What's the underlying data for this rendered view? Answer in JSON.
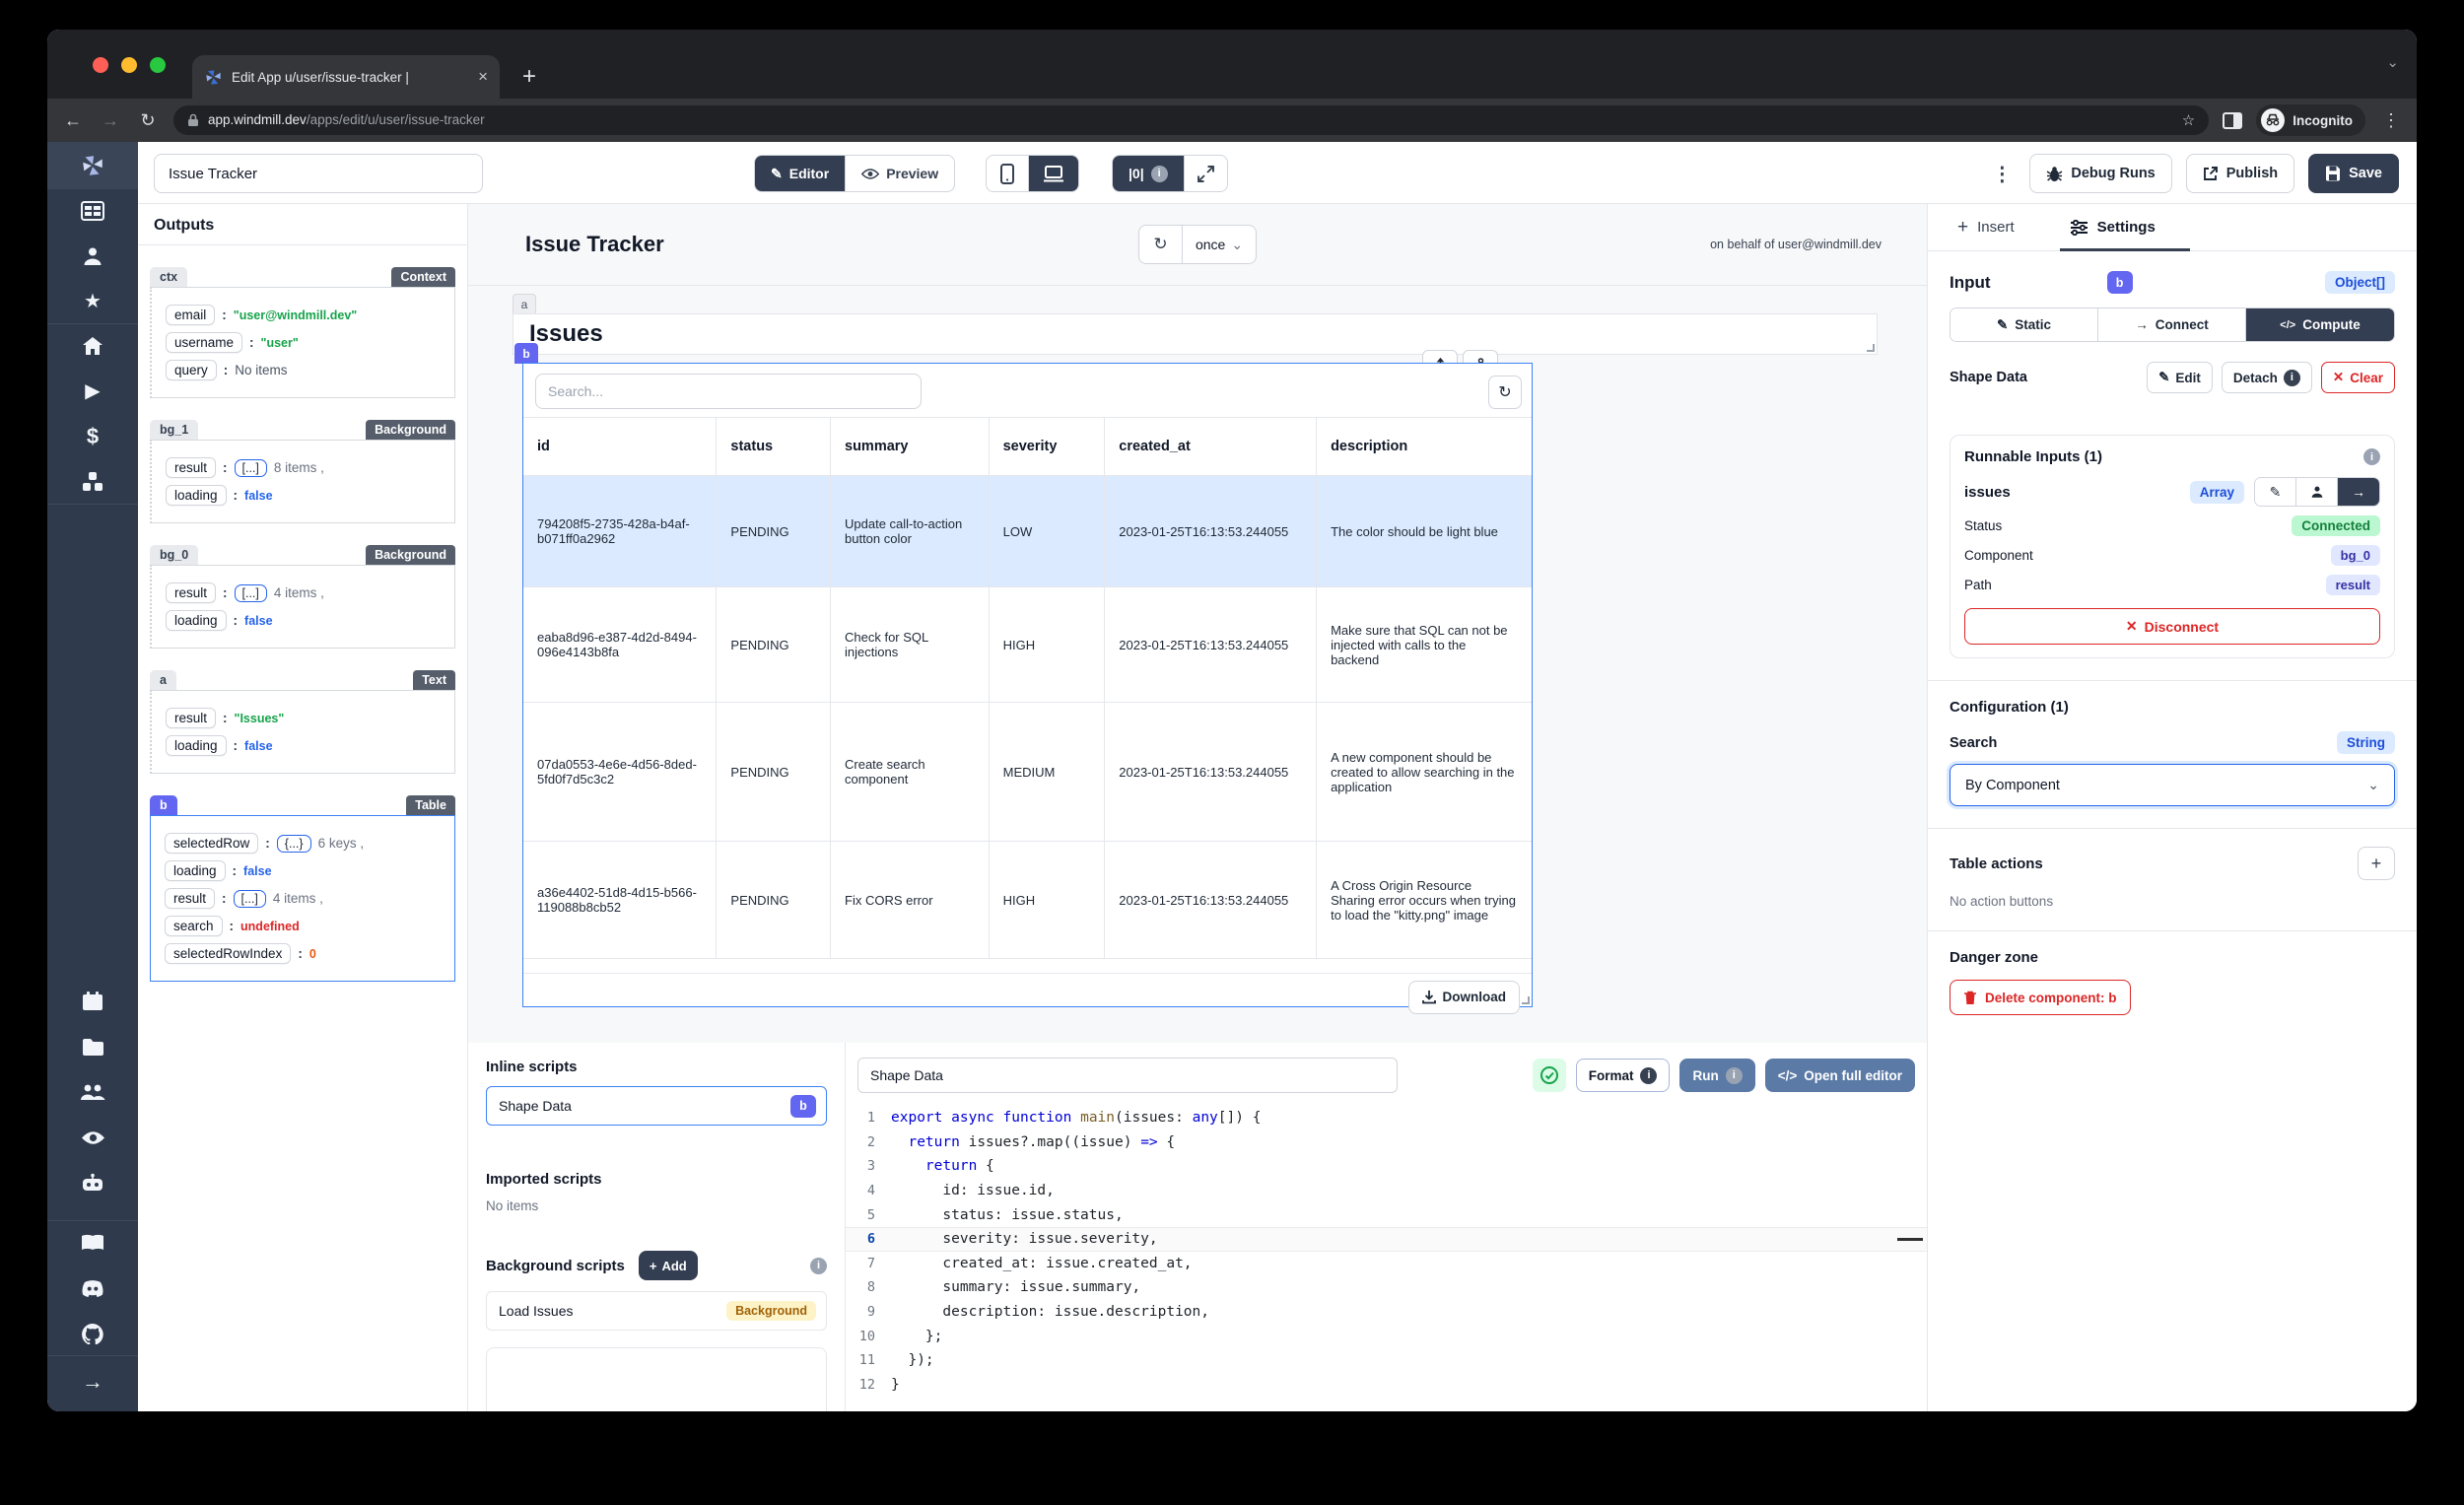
{
  "punct": {
    "colon": ":"
  },
  "icons": {
    "back": "←",
    "forward": "→",
    "reload": "↻",
    "more": "⋮",
    "plus": "+",
    "close": "×",
    "chevron_down": "⌄",
    "star": "☆",
    "pencil": "✎",
    "refresh": "↻",
    "code": "</>",
    "zero": "|0|",
    "arrow_right": "→",
    "times": "✕",
    "info": "i",
    "dollar": "$",
    "play": "▶",
    "home": "⌂",
    "star_filled": "★",
    "check": "✓"
  },
  "browser": {
    "tab_title": "Edit App u/user/issue-tracker |",
    "url_host": "app.windmill.dev",
    "url_path": "/apps/edit/u/user/issue-tracker",
    "incognito_label": "Incognito"
  },
  "toolbar": {
    "app_name_value": "Issue Tracker",
    "editor_label": "Editor",
    "preview_label": "Preview",
    "debug_runs_label": "Debug Runs",
    "publish_label": "Publish",
    "save_label": "Save"
  },
  "outputs": {
    "title": "Outputs",
    "sections": [
      {
        "id": "ctx",
        "badge": "Context",
        "rows": [
          {
            "key": "email",
            "value": "\"user@windmill.dev\""
          },
          {
            "key": "username",
            "value": "\"user\""
          },
          {
            "key": "query",
            "value": "No items"
          }
        ]
      },
      {
        "id": "bg_1",
        "badge": "Background",
        "rows": [
          {
            "key": "result",
            "chip": "[...]",
            "meta": "8 items ,"
          },
          {
            "key": "loading",
            "value": "false"
          }
        ]
      },
      {
        "id": "bg_0",
        "badge": "Background",
        "rows": [
          {
            "key": "result",
            "chip": "[...]",
            "meta": "4 items ,"
          },
          {
            "key": "loading",
            "value": "false"
          }
        ]
      },
      {
        "id": "a",
        "badge": "Text",
        "rows": [
          {
            "key": "result",
            "value": "\"Issues\""
          },
          {
            "key": "loading",
            "value": "false"
          }
        ]
      },
      {
        "id": "b",
        "badge": "Table",
        "rows": [
          {
            "key": "selectedRow",
            "chip": "{...}",
            "meta": "6 keys ,"
          },
          {
            "key": "loading",
            "value": "false"
          },
          {
            "key": "result",
            "chip": "[...]",
            "meta": "4 items ,"
          },
          {
            "key": "search",
            "value": "undefined"
          },
          {
            "key": "selectedRowIndex",
            "value": "0"
          }
        ]
      }
    ]
  },
  "canvas": {
    "app_title": "Issue Tracker",
    "refresh_mode": "once",
    "on_behalf": "on behalf of user@windmill.dev",
    "text_component": {
      "tag": "a",
      "text": "Issues"
    },
    "table": {
      "tag": "b",
      "search_placeholder": "Search...",
      "download_label": "Download",
      "columns": [
        "id",
        "status",
        "summary",
        "severity",
        "created_at",
        "description"
      ],
      "rows": [
        [
          "794208f5-2735-428a-b4af-b071ff0a2962",
          "PENDING",
          "Update call-to-action button color",
          "LOW",
          "2023-01-25T16:13:53.244055",
          "The color should be light blue"
        ],
        [
          "eaba8d96-e387-4d2d-8494-096e4143b8fa",
          "PENDING",
          "Check for SQL injections",
          "HIGH",
          "2023-01-25T16:13:53.244055",
          "Make sure that SQL can not be injected with calls to the backend"
        ],
        [
          "07da0553-4e6e-4d56-8ded-5fd0f7d5c3c2",
          "PENDING",
          "Create search component",
          "MEDIUM",
          "2023-01-25T16:13:53.244055",
          "A new component should be created to allow searching in the application"
        ],
        [
          "a36e4402-51d8-4d15-b566-119088b8cb52",
          "PENDING",
          "Fix CORS error",
          "HIGH",
          "2023-01-25T16:13:53.244055",
          "A Cross Origin Resource Sharing error occurs when trying to load the \"kitty.png\" image"
        ]
      ]
    }
  },
  "scripts_panel": {
    "inline_title": "Inline scripts",
    "inline_item": "Shape Data",
    "inline_item_badge": "b",
    "imported_title": "Imported scripts",
    "imported_empty": "No items",
    "background_title": "Background scripts",
    "add_label": "Add",
    "background_item": "Load Issues",
    "background_badge": "Background"
  },
  "editor": {
    "name_value": "Shape Data",
    "format_label": "Format",
    "run_label": "Run",
    "open_full_label": "Open full editor",
    "active_line": 6,
    "code_lines": [
      "export async function main(issues: any[]) {",
      "  return issues?.map((issue) => {",
      "    return {",
      "      id: issue.id,",
      "      status: issue.status,",
      "      severity: issue.severity,",
      "      created_at: issue.created_at,",
      "      summary: issue.summary,",
      "      description: issue.description,",
      "    };",
      "  });",
      "}"
    ]
  },
  "settings": {
    "insert_tab": "Insert",
    "settings_tab": "Settings",
    "input_label": "Input",
    "component_id": "b",
    "input_type": "Object[]",
    "static_label": "Static",
    "connect_label": "Connect",
    "compute_label": "Compute",
    "shape_data_label": "Shape Data",
    "edit_label": "Edit",
    "detach_label": "Detach",
    "clear_label": "Clear",
    "runnable": {
      "title": "Runnable Inputs (1)",
      "name": "issues",
      "type_badge": "Array",
      "status_label": "Status",
      "status_value": "Connected",
      "component_label": "Component",
      "component_value": "bg_0",
      "path_label": "Path",
      "path_value": "result",
      "disconnect_label": "Disconnect"
    },
    "configuration": {
      "title": "Configuration (1)",
      "search_label": "Search",
      "search_type": "String",
      "search_value": "By Component"
    },
    "table_actions": {
      "title": "Table actions",
      "empty": "No action buttons"
    },
    "danger": {
      "title": "Danger zone",
      "delete_label": "Delete component: b"
    }
  }
}
